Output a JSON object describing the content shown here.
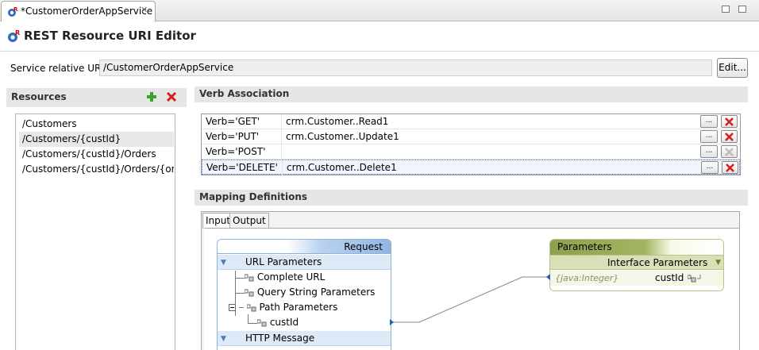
{
  "editor_tab": {
    "title": "*CustomerOrderAppService"
  },
  "header": {
    "title": "REST Resource URI Editor"
  },
  "service_uri": {
    "label": "Service relative URI:",
    "value": "/CustomerOrderAppService",
    "edit_button": "Edit..."
  },
  "resources": {
    "title": "Resources",
    "items": [
      "/Customers",
      "/Customers/{custId}",
      "/Customers/{custId}/Orders",
      "/Customers/{custId}/Orders/{orde..."
    ],
    "selected_index": 1
  },
  "verb_association": {
    "title": "Verb Association",
    "rows": [
      {
        "verb": "Verb='GET'",
        "operation": "crm.Customer..Read1",
        "delete_enabled": true
      },
      {
        "verb": "Verb='PUT'",
        "operation": "crm.Customer..Update1",
        "delete_enabled": true
      },
      {
        "verb": "Verb='POST'",
        "operation": "",
        "delete_enabled": false
      },
      {
        "verb": "Verb='DELETE'",
        "operation": "crm.Customer..Delete1",
        "delete_enabled": true
      }
    ],
    "browse_label": "...",
    "selected_index": 3
  },
  "mapping": {
    "title": "Mapping Definitions",
    "tabs": [
      "Input",
      "Output"
    ],
    "active_tab": "Input",
    "request": {
      "title": "Request",
      "url_parameters": "URL Parameters",
      "complete_url": "Complete URL",
      "query_string": "Query String Parameters",
      "path_parameters": "Path Parameters",
      "cust_id": "custId",
      "http_message": "HTTP Message"
    },
    "parameters": {
      "title": "Parameters",
      "interface": "Interface Parameters",
      "type": "{java:Integer}",
      "name": "custId"
    }
  },
  "colors": {
    "accent_blue": "#1f5fbf",
    "delete_red": "#d42020",
    "add_green": "#3aa12a"
  }
}
